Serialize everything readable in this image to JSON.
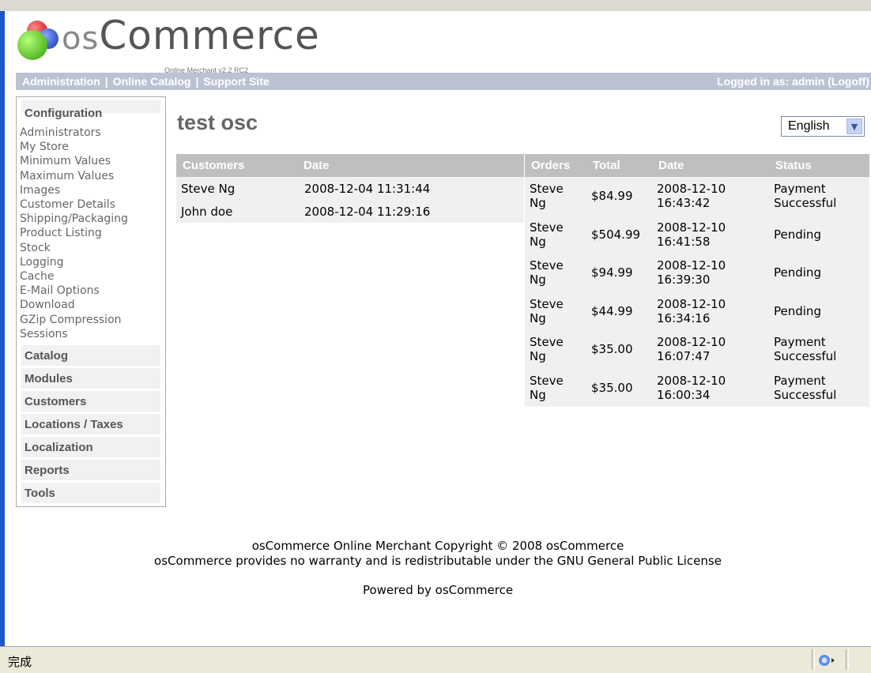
{
  "header": {
    "logo_text_os": "os",
    "logo_text_commerce": "Commerce",
    "logo_sub": "Online Merchant v2.2 RC2",
    "nav_links": [
      "Administration",
      "Online Catalog",
      "Support Site"
    ],
    "logged_in": "Logged in as: admin (Logoff)"
  },
  "sidebar": {
    "configuration": {
      "title": "Configuration",
      "items": [
        "Administrators",
        "My Store",
        "Minimum Values",
        "Maximum Values",
        "Images",
        "Customer Details",
        "Shipping/Packaging",
        "Product Listing",
        "Stock",
        "Logging",
        "Cache",
        "E-Mail Options",
        "Download",
        "GZip Compression",
        "Sessions"
      ]
    },
    "boxes": [
      "Catalog",
      "Modules",
      "Customers",
      "Locations / Taxes",
      "Localization",
      "Reports",
      "Tools"
    ]
  },
  "main": {
    "title": "test osc",
    "language": "English"
  },
  "customers_table": {
    "headers": [
      "Customers",
      "Date"
    ],
    "rows": [
      [
        "Steve Ng",
        "2008-12-04 11:31:44"
      ],
      [
        "John doe",
        "2008-12-04 11:29:16"
      ]
    ]
  },
  "orders_table": {
    "headers": [
      "Orders",
      "Total",
      "Date",
      "Status"
    ],
    "rows": [
      {
        "name1": "Steve",
        "name2": "Ng",
        "total": "$84.99",
        "date1": "2008-12-10",
        "date2": "16:43:42",
        "status1": "Payment",
        "status2": "Successful"
      },
      {
        "name1": "Steve",
        "name2": "Ng",
        "total": "$504.99",
        "date1": "2008-12-10",
        "date2": "16:41:58",
        "status1": "Pending",
        "status2": ""
      },
      {
        "name1": "Steve",
        "name2": "Ng",
        "total": "$94.99",
        "date1": "2008-12-10",
        "date2": "16:39:30",
        "status1": "Pending",
        "status2": ""
      },
      {
        "name1": "Steve",
        "name2": "Ng",
        "total": "$44.99",
        "date1": "2008-12-10",
        "date2": "16:34:16",
        "status1": "Pending",
        "status2": ""
      },
      {
        "name1": "Steve",
        "name2": "Ng",
        "total": "$35.00",
        "date1": "2008-12-10",
        "date2": "16:07:47",
        "status1": "Payment",
        "status2": "Successful"
      },
      {
        "name1": "Steve",
        "name2": "Ng",
        "total": "$35.00",
        "date1": "2008-12-10",
        "date2": "16:00:34",
        "status1": "Payment",
        "status2": "Successful"
      }
    ]
  },
  "footer": {
    "line1": "osCommerce Online Merchant Copyright © 2008 osCommerce",
    "line2": "osCommerce provides no warranty and is redistributable under the GNU General Public License",
    "powered": "Powered by osCommerce"
  },
  "status_bar": {
    "text": "完成"
  },
  "colors": {
    "nav_bar": "#bbc3d3",
    "table_header": "#bfbfbf",
    "table_cell": "#f0f0f0",
    "window_edge": "#1c58c9"
  }
}
